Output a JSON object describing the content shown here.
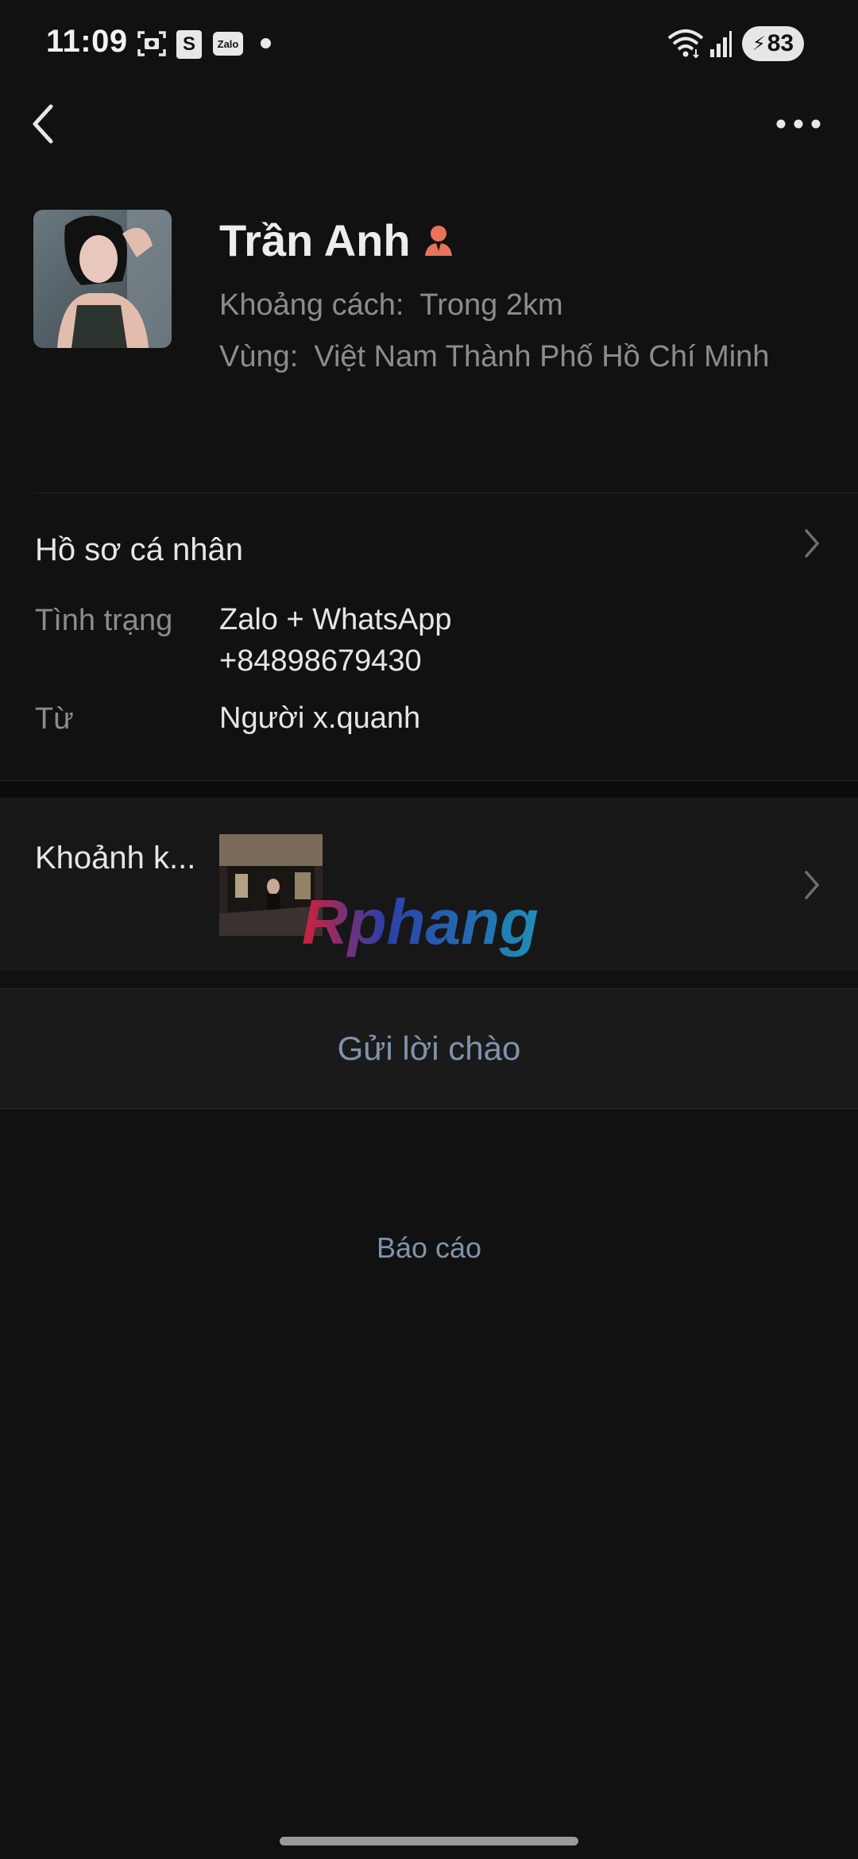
{
  "status_bar": {
    "time": "11:09",
    "battery": "83",
    "zalo_badge": "Zalo",
    "shopee_badge": "S",
    "icons": [
      "screenshot-icon",
      "shopee-icon",
      "zalo-icon",
      "wifi-icon",
      "signal-icon",
      "battery-icon"
    ]
  },
  "profile": {
    "name": "Trần Anh",
    "distance_label": "Khoảng cách:",
    "distance_value": "Trong 2km",
    "region_label": "Vùng:",
    "region_value": "Việt Nam  Thành Phố Hồ Chí Minh"
  },
  "personal_section": {
    "title": "Hồ sơ cá nhân",
    "rows": [
      {
        "label": "Tình trạng",
        "value": "Zalo + WhatsApp +84898679430"
      },
      {
        "label": "Từ",
        "value": "Người x.quanh"
      }
    ]
  },
  "moments": {
    "label": "Khoảnh k...",
    "watermark": "Rphang"
  },
  "actions": {
    "greet": "Gửi lời chào",
    "report": "Báo cáo"
  },
  "colors": {
    "background": "#111111",
    "link": "#7e93ad",
    "gender_icon": "#e8735a"
  }
}
